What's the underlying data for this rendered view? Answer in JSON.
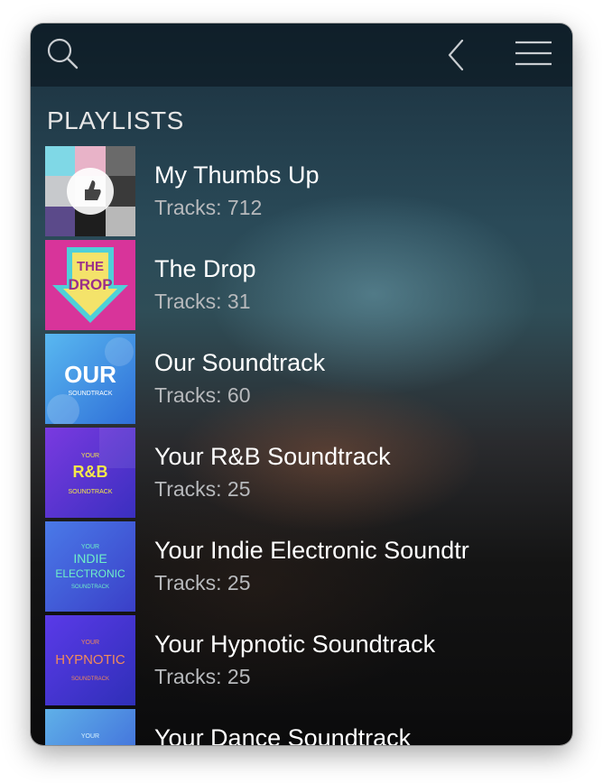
{
  "header": {
    "search_icon": "search-icon",
    "back_icon": "chevron-left-icon",
    "menu_icon": "hamburger-menu-icon"
  },
  "section_title": "PLAYLISTS",
  "playlists": [
    {
      "title": "My Thumbs Up",
      "tracks": "Tracks: 712",
      "art": "thumbs-up-collage-art"
    },
    {
      "title": "The Drop",
      "tracks": "Tracks: 31",
      "art_text": [
        "THE",
        "DROP"
      ],
      "art": "the-drop-art"
    },
    {
      "title": "Our Soundtrack",
      "tracks": "Tracks: 60",
      "art_text": [
        "OUR",
        "SOUNDTRACK"
      ],
      "art": "our-soundtrack-art"
    },
    {
      "title": "Your R&B Soundtrack",
      "tracks": "Tracks: 25",
      "art_text": [
        "YOUR",
        "R&B",
        "SOUNDTRACK"
      ],
      "art": "rnb-soundtrack-art"
    },
    {
      "title": "Your Indie Electronic Soundtr",
      "tracks": "Tracks: 25",
      "art_text": [
        "YOUR",
        "INDIE",
        "ELECTRONIC",
        "SOUNDTRACK"
      ],
      "art": "indie-electronic-art"
    },
    {
      "title": "Your Hypnotic Soundtrack",
      "tracks": "Tracks: 25",
      "art_text": [
        "YOUR",
        "HYPNOTIC",
        "SOUNDTRACK"
      ],
      "art": "hypnotic-soundtrack-art"
    },
    {
      "title": "Your Dance Soundtrack",
      "tracks": "",
      "art_text": [
        "YOUR"
      ],
      "art": "dance-soundtrack-art"
    }
  ],
  "colors": {
    "drop_bg": "#d8349a",
    "drop_arrow": "#4fd0d8",
    "drop_text": "#9a2f8a",
    "our_bg": "#3fa0e6",
    "rnb_bg": "#5a2fd0",
    "rnb_text": "#f5e84a",
    "indie_bg": "#3f5fe0",
    "indie_text": "#6ff0c8",
    "hypnotic_bg": "#3d2fd6",
    "hypnotic_text": "#f08a5a"
  }
}
